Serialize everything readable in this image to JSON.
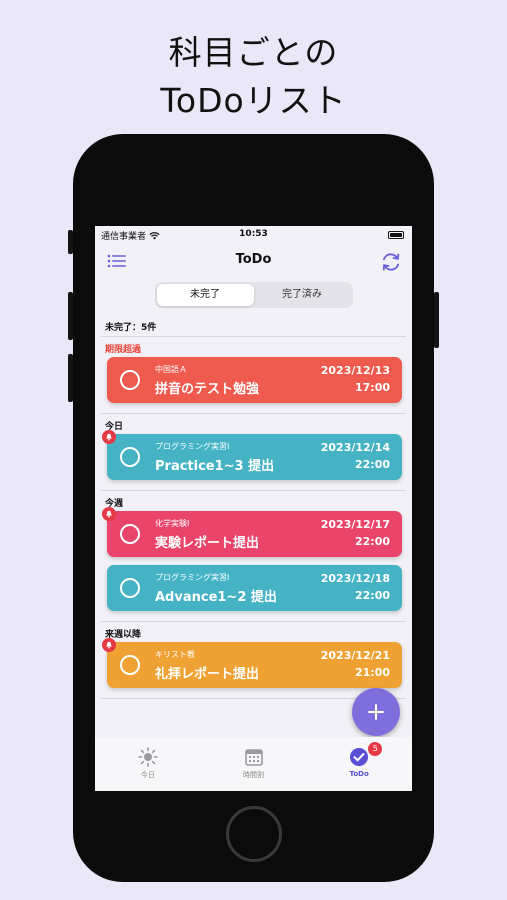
{
  "headline": {
    "line1": "科目ごとの",
    "line2": "ToDoリスト"
  },
  "status_bar": {
    "carrier": "通信事業者",
    "time": "10:53"
  },
  "nav": {
    "title": "ToDo",
    "left_icon": "list-icon",
    "right_icon": "refresh-icon"
  },
  "segments": [
    {
      "label": "未完了",
      "selected": true
    },
    {
      "label": "完了済み",
      "selected": false
    }
  ],
  "summary": "未完了：5件",
  "sections": [
    {
      "label": "期限超過",
      "tasks": [
        {
          "subject": "中国語Ａ",
          "title": "拼音のテスト勉強",
          "date": "2023/12/13",
          "time": "17:00",
          "color": "#ef5a4e",
          "reminder": false
        }
      ]
    },
    {
      "label": "今日",
      "tasks": [
        {
          "subject": "プログラミング実習Ⅰ",
          "title": "Practice1~3 提出",
          "date": "2023/12/14",
          "time": "22:00",
          "color": "#45b3c4",
          "reminder": true
        }
      ]
    },
    {
      "label": "今週",
      "tasks": [
        {
          "subject": "化学実験Ⅰ",
          "title": "実験レポート提出",
          "date": "2023/12/17",
          "time": "22:00",
          "color": "#e9456a",
          "reminder": true
        },
        {
          "subject": "プログラミング実習Ⅰ",
          "title": "Advance1~2 提出",
          "date": "2023/12/18",
          "time": "22:00",
          "color": "#45b3c4",
          "reminder": false
        }
      ]
    },
    {
      "label": "来週以降",
      "tasks": [
        {
          "subject": "キリスト教",
          "title": "礼拝レポート提出",
          "date": "2023/12/21",
          "time": "21:00",
          "color": "#efa233",
          "reminder": true
        }
      ]
    }
  ],
  "fab": {
    "icon": "plus-icon"
  },
  "tabs": [
    {
      "label": "今日",
      "icon": "sun-icon",
      "active": false
    },
    {
      "label": "時間割",
      "icon": "calendar-icon",
      "active": false
    },
    {
      "label": "ToDo",
      "icon": "check-circle-icon",
      "active": true,
      "badge": "5"
    }
  ],
  "colors": {
    "accent": "#5b4fd6",
    "overdue": "#e8453c",
    "badge": "#e63946"
  }
}
